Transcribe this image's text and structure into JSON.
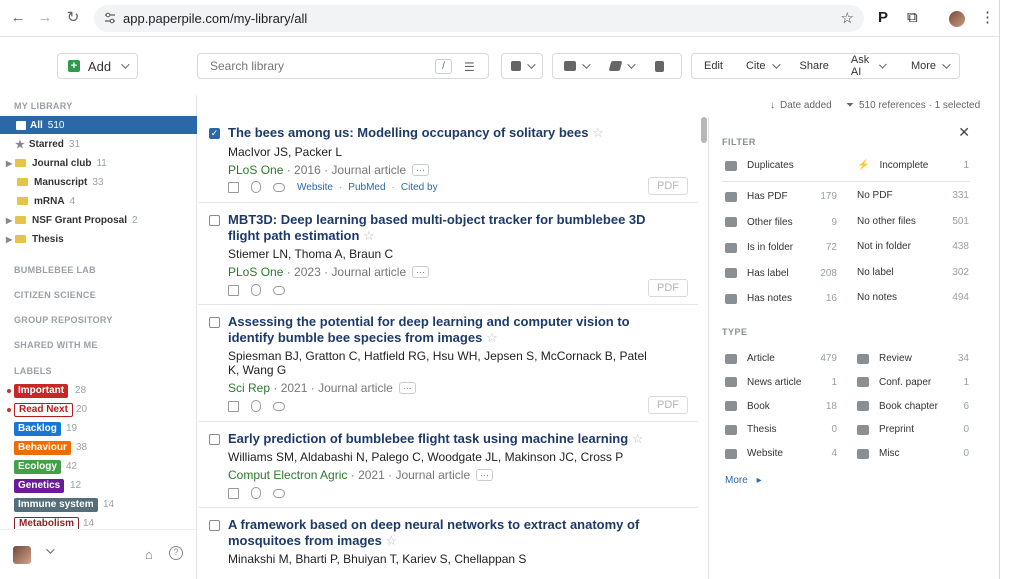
{
  "browser": {
    "url": "app.paperpile.com/my-library/all"
  },
  "toolbar": {
    "add_label": "Add",
    "search_placeholder": "Search library",
    "slash_key": "/",
    "actions": [
      "Edit",
      "Cite",
      "Share",
      "Ask AI",
      "More"
    ]
  },
  "sidebar": {
    "my_library_label": "MY LIBRARY",
    "items": [
      {
        "label": "All",
        "count": "510",
        "active": true
      },
      {
        "label": "Starred",
        "count": "31"
      },
      {
        "label": "Journal club",
        "count": "11"
      },
      {
        "label": "Manuscript",
        "count": "33"
      },
      {
        "label": "mRNA",
        "count": "4"
      },
      {
        "label": "NSF Grant Proposal",
        "count": "2"
      },
      {
        "label": "Thesis",
        "count": ""
      }
    ],
    "groups": [
      "BUMBLEBEE LAB",
      "CITIZEN SCIENCE",
      "GROUP REPOSITORY",
      "SHARED WITH ME"
    ],
    "labels_heading": "LABELS",
    "labels": [
      {
        "name": "Important",
        "count": "28",
        "color": "#c62828"
      },
      {
        "name": "Read Next",
        "count": "20",
        "color": "#b71c1c"
      },
      {
        "name": "Backlog",
        "count": "19",
        "color": "#1976d2"
      },
      {
        "name": "Behaviour",
        "count": "38",
        "color": "#ef6c00"
      },
      {
        "name": "Ecology",
        "count": "42",
        "color": "#43a047"
      },
      {
        "name": "Genetics",
        "count": "12",
        "color": "#6a1b9a"
      },
      {
        "name": "Immune system",
        "count": "14",
        "color": "#546e7a"
      },
      {
        "name": "Metabolism",
        "count": "14",
        "color": "#8d2525"
      }
    ]
  },
  "list_header": {
    "sort": "Date added",
    "summary": "510 references · 1 selected"
  },
  "papers": [
    {
      "title": "The bees among us: Modelling occupancy of solitary bees",
      "authors": "MacIvor JS, Packer L",
      "journal": "PLoS One",
      "year": "2016",
      "type": "Journal article",
      "links": [
        "Website",
        "PubMed",
        "Cited by"
      ],
      "checked": true,
      "pdf": "PDF"
    },
    {
      "title": "MBT3D: Deep learning based multi-object tracker for bumblebee 3D flight path estimation",
      "authors": "Stiemer LN, Thoma A, Braun C",
      "journal": "PLoS One",
      "year": "2023",
      "type": "Journal article",
      "checked": false,
      "pdf": "PDF"
    },
    {
      "title": "Assessing the potential for deep learning and computer vision to identify bumble bee species from images",
      "authors": "Spiesman BJ, Gratton C, Hatfield RG, Hsu WH, Jepsen S, McCornack B, Patel K, Wang G",
      "journal": "Sci Rep",
      "year": "2021",
      "type": "Journal article",
      "checked": false,
      "pdf": "PDF"
    },
    {
      "title": "Early prediction of bumblebee flight task using machine learning",
      "authors": "Williams SM, Aldabashi N, Palego C, Woodgate JL, Makinson JC, Cross P",
      "journal": "Comput Electron Agric",
      "year": "2021",
      "type": "Journal article",
      "checked": false
    },
    {
      "title": "A framework based on deep neural networks to extract anatomy of mosquitoes from images",
      "authors": "Minakshi M, Bharti P, Bhuiyan T, Kariev S, Chellappan S",
      "checked": false
    }
  ],
  "filter": {
    "heading": "FILTER",
    "rows": [
      {
        "l": "Duplicates",
        "ln": "",
        "r": "Incomplete",
        "rn": "1"
      },
      {
        "l": "Has PDF",
        "ln": "179",
        "r": "No PDF",
        "rn": "331"
      },
      {
        "l": "Other files",
        "ln": "9",
        "r": "No other files",
        "rn": "501"
      },
      {
        "l": "Is in folder",
        "ln": "72",
        "r": "Not in folder",
        "rn": "438"
      },
      {
        "l": "Has label",
        "ln": "208",
        "r": "No label",
        "rn": "302"
      },
      {
        "l": "Has notes",
        "ln": "16",
        "r": "No notes",
        "rn": "494"
      }
    ],
    "type_heading": "TYPE",
    "types": [
      {
        "l": "Article",
        "ln": "479",
        "r": "Review",
        "rn": "34"
      },
      {
        "l": "News article",
        "ln": "1",
        "r": "Conf. paper",
        "rn": "1"
      },
      {
        "l": "Book",
        "ln": "18",
        "r": "Book chapter",
        "rn": "6"
      },
      {
        "l": "Thesis",
        "ln": "0",
        "r": "Preprint",
        "rn": "0"
      },
      {
        "l": "Website",
        "ln": "4",
        "r": "Misc",
        "rn": "0"
      }
    ],
    "more": "More"
  }
}
